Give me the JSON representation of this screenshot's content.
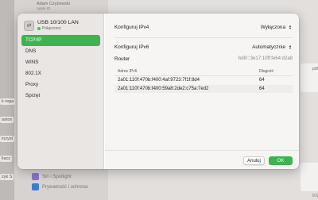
{
  "background": {
    "user_name": "Adam Czyżewski",
    "user_sub": "Apple ID",
    "left_fragments": [
      "k rega",
      "astox",
      "inzyst",
      "liacz",
      "zyk S"
    ],
    "sidebar_items": [
      {
        "label": "Siri i Spotlight",
        "icon": "siri-icon",
        "color": "#8e6fd1"
      },
      {
        "label": "Prywatność i ochrona",
        "icon": "hand-icon",
        "color": "#3a7bd5"
      }
    ],
    "right_fragments": [
      ".pdf",
      "0.5"
    ]
  },
  "dialog": {
    "device": {
      "title": "USB 10/100 LAN",
      "status": "Połączono",
      "status_color": "#34c759"
    },
    "nav": [
      {
        "label": "TCP/IP",
        "active": true
      },
      {
        "label": "DNS",
        "active": false
      },
      {
        "label": "WINS",
        "active": false
      },
      {
        "label": "802.1X",
        "active": false
      },
      {
        "label": "Proxy",
        "active": false
      },
      {
        "label": "Sprzęt",
        "active": false
      }
    ],
    "ipv4": {
      "label": "Konfiguruj IPv4",
      "value": "Wyłączona"
    },
    "ipv6": {
      "label": "Konfiguruj IPv6",
      "value": "Automatycznie"
    },
    "router": {
      "label": "Router",
      "value": "fe80::3e17:10ff:fe64:d2a8"
    },
    "table": {
      "headers": [
        "Adres IPv6",
        "Długość"
      ],
      "rows": [
        {
          "address": "2a01:110f:470b:f400:4af:9723:7f1f:8d4",
          "length": "64"
        },
        {
          "address": "2a01:110f:470b:f400:59a8:2de2:c75a:7ed2",
          "length": "64"
        }
      ]
    },
    "buttons": {
      "cancel": "Anuluj",
      "ok": "OK"
    },
    "accent": "#3eb34f"
  }
}
